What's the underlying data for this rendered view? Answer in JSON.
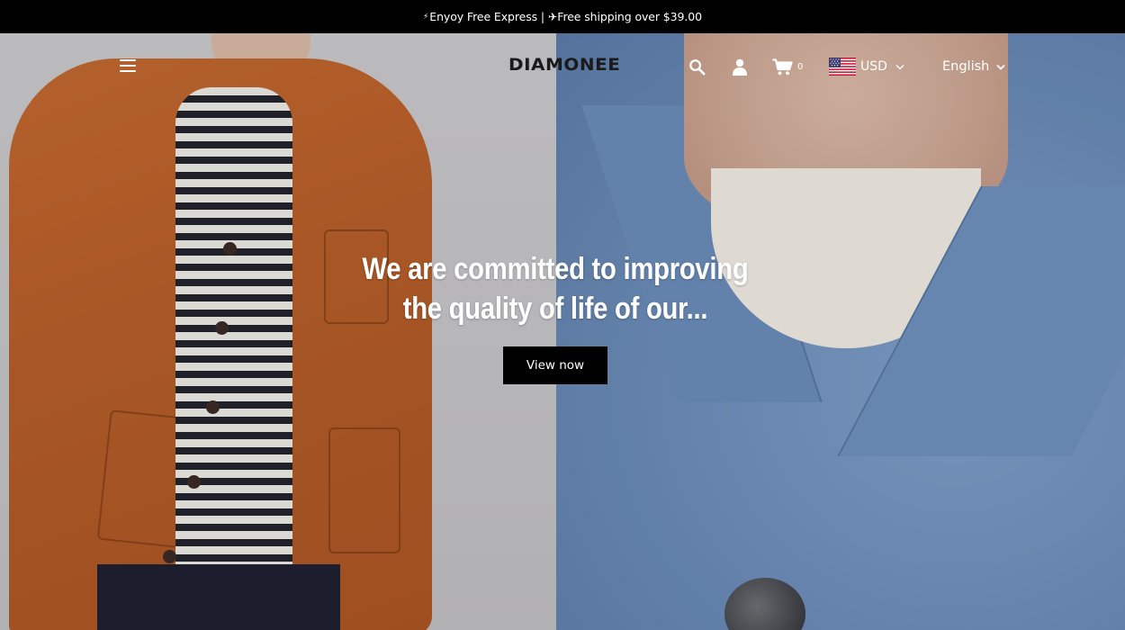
{
  "announcement": {
    "bolt": "⚡",
    "text": "Enyoy Free Express | ✈Free shipping over $39.00"
  },
  "header": {
    "logo": "DIAMONEE",
    "menu_icon": "hamburger-menu-icon",
    "search_icon": "search-icon",
    "user_icon": "user-icon",
    "cart_icon": "cart-icon",
    "cart_count": "0",
    "currency": {
      "flag": "us-flag-icon",
      "label": "USD"
    },
    "language": {
      "label": "English"
    }
  },
  "hero": {
    "title_line1": "We are committed to improving",
    "title_line2": "the quality of life of our...",
    "cta_label": "View now"
  },
  "colors": {
    "announcement_bg": "#000000",
    "cta_bg": "#000000",
    "text_light": "#ffffff",
    "logo": "#1a1a1a"
  }
}
